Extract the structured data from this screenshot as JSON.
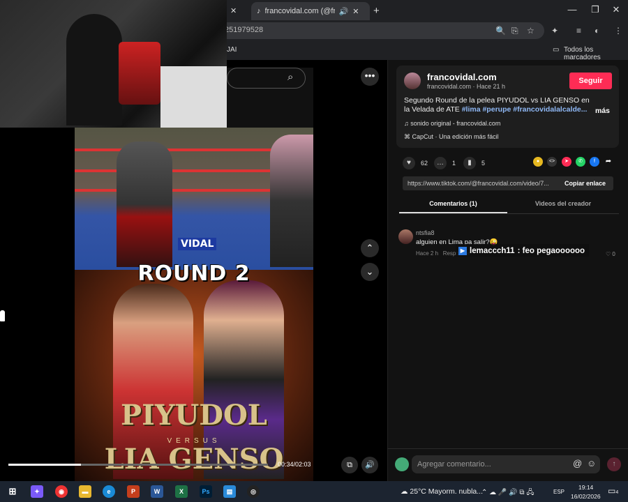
{
  "browser": {
    "tab_title": "francovidal.com (@francovi",
    "url_fragment": "251979528",
    "bookmark_fragment": "JAI",
    "bookmarks_label": "Todos los marcadores"
  },
  "video": {
    "round_text": "ROUND 2",
    "ring_logo": "VIDAL",
    "fighter1_name": "PIYUDOL",
    "versus": "VERSUS",
    "fighter2_name": "LIA GENSO",
    "time": "00:34/02:03",
    "progress": 0.28
  },
  "post": {
    "username": "francovidal.com",
    "subline": "francovidal.com · Hace 21 h",
    "follow_label": "Seguir",
    "description": "Segundo Round de la pelea PIYUDOL vs LIA GENSO en la Velada de ATE",
    "tags": "#lima #perupe #francovidalalcalde...",
    "more_label": "más",
    "sound": "sonido original - francovidal.com",
    "capcut": "CapCut · Una edición más fácil",
    "likes": "62",
    "comments": "1",
    "saves": "5",
    "link": "https://www.tiktok.com/@francovidal.com/video/7...",
    "copy_link_label": "Copiar enlace",
    "tab_comments": "Comentarios (1)",
    "tab_creator": "Videos del creador"
  },
  "comment": {
    "user": "ntsfia8",
    "text": "alguien en Lima pa salir?😜",
    "time": "Hace 2 h",
    "reply": "Responder",
    "likes": "0"
  },
  "overlay_chat": {
    "user": "lemaccch11",
    "text": ": feo pegaoooooo"
  },
  "composer": {
    "placeholder": "Agregar comentario..."
  },
  "taskbar": {
    "weather": "25°C  Mayorm. nubla...",
    "lang": "ESP",
    "time": "19:14",
    "date": "16/02/2026",
    "notifications": "4"
  }
}
